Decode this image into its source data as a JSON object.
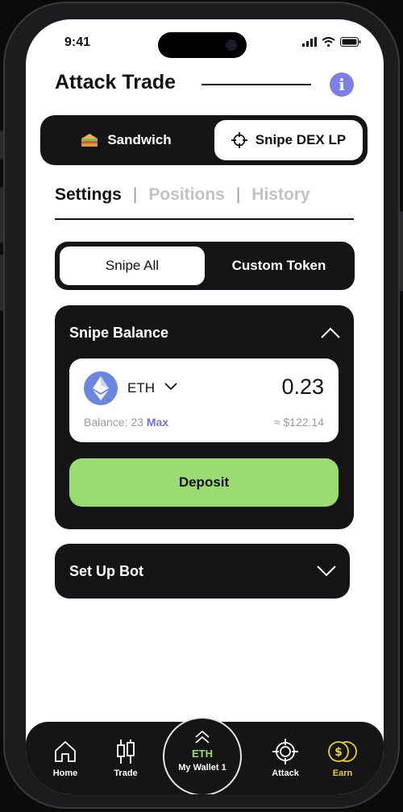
{
  "status": {
    "time": "9:41"
  },
  "header": {
    "title": "Attack Trade",
    "info_glyph": "i"
  },
  "mode_switch": {
    "left": {
      "label": "Sandwich",
      "icon": "sandwich-icon"
    },
    "right": {
      "label": "Snipe DEX LP",
      "icon": "crosshair-icon"
    }
  },
  "tabs": [
    {
      "label": "Settings",
      "active": true
    },
    {
      "label": "Positions",
      "active": false
    },
    {
      "label": "History",
      "active": false
    }
  ],
  "tab_separator": "|",
  "scope": {
    "option_a": "Snipe All",
    "option_b": "Custom Token"
  },
  "snipe_balance": {
    "title": "Snipe Balance",
    "token": "ETH",
    "amount": "0.23",
    "balance_label": "Balance: 23",
    "max_label": "Max",
    "usd_value": "≈ $122.14",
    "deposit_label": "Deposit"
  },
  "setup_bot": {
    "title": "Set Up Bot"
  },
  "tabbar": {
    "home": "Home",
    "trade": "Trade",
    "wallet_token": "ETH",
    "wallet_name": "My Wallet 1",
    "attack": "Attack",
    "earn": "Earn"
  },
  "colors": {
    "dark": "#151518",
    "accent_purple": "#7b7fe6",
    "deposit_green": "#9adb72",
    "earn_yellow": "#ead12b"
  }
}
